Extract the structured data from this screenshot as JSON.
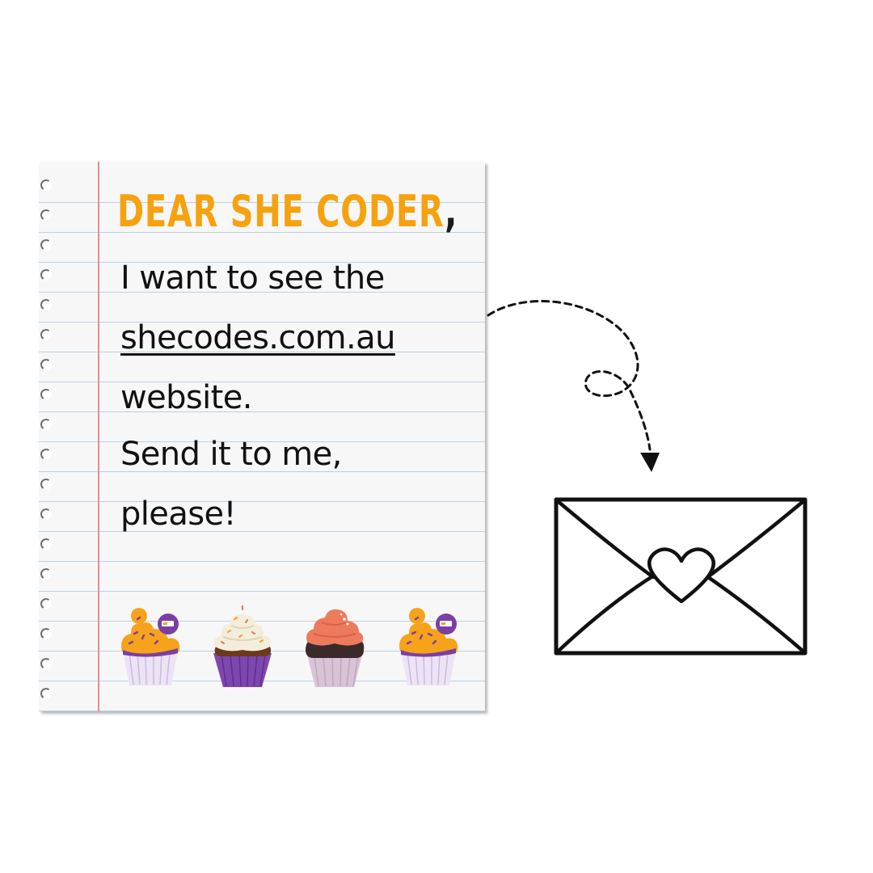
{
  "letter": {
    "greeting": "DEAR SHE CODER",
    "greeting_punct": ",",
    "line1": "I want to see the",
    "link_text": "shecodes.com.au",
    "line3": "website.",
    "line4": "Send it to me,",
    "line5": "please!"
  },
  "cupcakes": [
    {
      "name": "orange-purple-cupcake",
      "frosting": "#f7a21b",
      "wrapper": "#ece4f5",
      "badge": "#7b3fa4"
    },
    {
      "name": "vanilla-sprinkle-cupcake",
      "frosting": "#f3eedc",
      "wrapper": "#7e47b0"
    },
    {
      "name": "coral-chocolate-cupcake",
      "frosting": "#ee7a5e",
      "wrapper": "#d8c4d6"
    },
    {
      "name": "orange-purple-cupcake",
      "frosting": "#f7a21b",
      "wrapper": "#ece4f5",
      "badge": "#7b3fa4"
    }
  ],
  "colors": {
    "accent": "#f6a20e",
    "text": "#111111",
    "margin_line": "#ef8a8a",
    "rule_line": "#b9d1e6"
  },
  "icons": [
    "dashed-arrow-icon",
    "envelope-heart-icon"
  ]
}
